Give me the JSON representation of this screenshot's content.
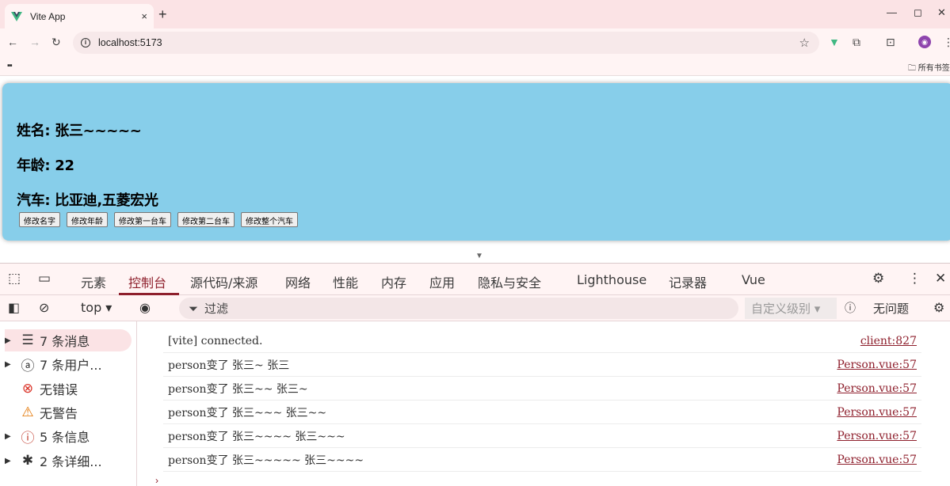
{
  "browser": {
    "tab_title": "Vite App",
    "tab_close": "×",
    "new_tab": "+",
    "url": "localhost:5173",
    "all_bookmarks": "所有书签"
  },
  "page": {
    "name_line": "姓名: 张三~~~~~",
    "age_line": "年龄: 22",
    "car_line": "汽车: 比亚迪,五菱宏光",
    "buttons": [
      "修改名字",
      "修改年龄",
      "修改第一台车",
      "修改第二台车",
      "修改整个汽车"
    ],
    "card_color": "#87ceea"
  },
  "devtools": {
    "tabs": [
      "元素",
      "控制台",
      "源代码/来源",
      "网络",
      "性能",
      "内存",
      "应用",
      "隐私与安全",
      "Lighthouse",
      "记录器",
      "Vue"
    ],
    "active_tab": "控制台",
    "context": "top ▾",
    "filter_placeholder": "过滤",
    "level_select": "自定义级别 ▾",
    "issues": "无问题",
    "sidebar": [
      {
        "label": "7 条消息",
        "icon": "list-icon",
        "expandable": true
      },
      {
        "label": "7 条用户...",
        "icon": "user-icon",
        "expandable": true
      },
      {
        "label": "无错误",
        "icon": "error-icon",
        "expandable": false
      },
      {
        "label": "无警告",
        "icon": "warning-icon",
        "expandable": false
      },
      {
        "label": "5 条信息",
        "icon": "info-icon",
        "expandable": true
      },
      {
        "label": "2 条详细...",
        "icon": "bug-icon",
        "expandable": true
      }
    ],
    "logs": [
      {
        "message": "[vite] connected.",
        "source": "client:827"
      },
      {
        "message": "person变了 张三~ 张三",
        "source": "Person.vue:57"
      },
      {
        "message": "person变了 张三~~ 张三~",
        "source": "Person.vue:57"
      },
      {
        "message": "person变了 张三~~~ 张三~~",
        "source": "Person.vue:57"
      },
      {
        "message": "person变了 张三~~~~ 张三~~~",
        "source": "Person.vue:57"
      },
      {
        "message": "person变了 张三~~~~~ 张三~~~~",
        "source": "Person.vue:57"
      }
    ],
    "accent_color": "#8e1f2c"
  }
}
